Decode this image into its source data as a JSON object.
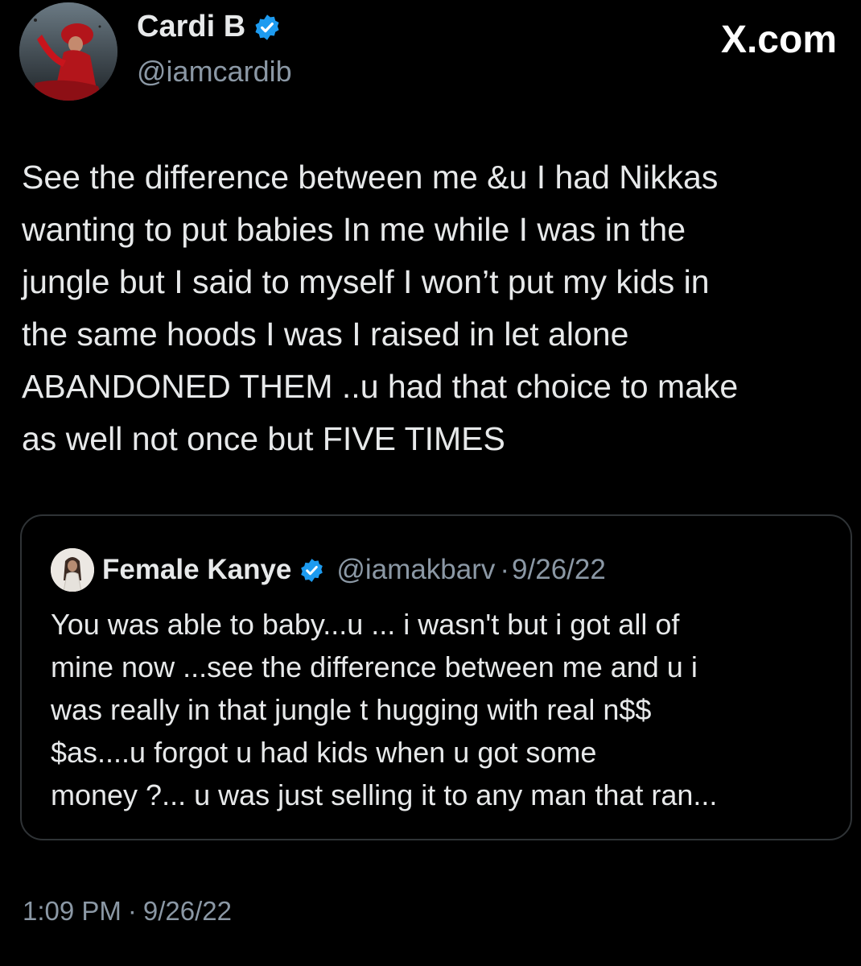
{
  "tweet": {
    "author": {
      "name": "Cardi B",
      "handle": "@iamcardib",
      "verified": true,
      "verified_color": "#1d9bf0"
    },
    "brand": "X.com",
    "text": "See the difference between me &u I had Nikkas\nwanting to put babies In me while I was in the\njungle but I said to myself I won’t put my kids in\nthe same hoods I was I raised in let alone\nABANDONED THEM ..u had that choice to make\nas well not once but FIVE TIMES",
    "quoted": {
      "name": "Female Kanye",
      "handle": "@iamakbarv",
      "separator": "·",
      "date": "9/26/22",
      "verified": true,
      "text": "You was able to baby...u ... i wasn't but i got all of\nmine now ...see the difference between me and u i\nwas really in that jungle t hugging with real n$$\n$as....u forgot u had kids when u got some\nmoney ?... u was just selling it to any man that ran..."
    },
    "time": "1:09 PM",
    "separator": "·",
    "date": "9/26/22"
  },
  "colors": {
    "background": "#000000",
    "text_primary": "#e7e9ea",
    "text_secondary": "#8b98a5",
    "border": "#2f3336",
    "verified": "#1d9bf0"
  },
  "icons": {
    "verified": "verified-badge-icon",
    "brand": "x-logo-icon"
  }
}
